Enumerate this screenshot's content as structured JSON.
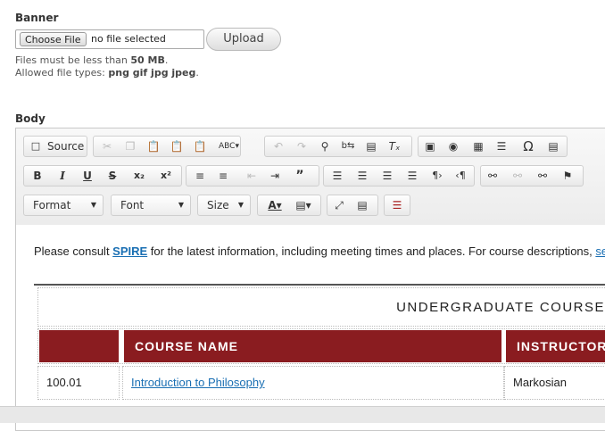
{
  "banner": {
    "label": "Banner",
    "choose_file_label": "Choose File",
    "file_status": "no file selected",
    "upload_label": "Upload",
    "help_size_prefix": "Files must be less than ",
    "help_size_value": "50 MB",
    "help_types_prefix": "Allowed file types: ",
    "help_types_value": "png gif jpg jpeg"
  },
  "body": {
    "label": "Body"
  },
  "toolbar": {
    "source_label": "Source",
    "format_label": "Format",
    "font_label": "Font",
    "size_label": "Size"
  },
  "content": {
    "intro_before": "Please consult ",
    "spire_link": "SPIRE",
    "intro_after": " for the latest information, including meeting times and places. For course descriptions, ",
    "se_link": "se",
    "table_title": "UNDERGRADUATE COURSE",
    "col_course_name": "COURSE NAME",
    "col_instructor": "INSTRUCTOR",
    "rows": [
      {
        "number": "100.01",
        "course": "Introduction to Philosophy",
        "instructor": "Markosian"
      }
    ]
  },
  "colors": {
    "header_bg": "#8a1c20",
    "link": "#1a6fb3"
  }
}
